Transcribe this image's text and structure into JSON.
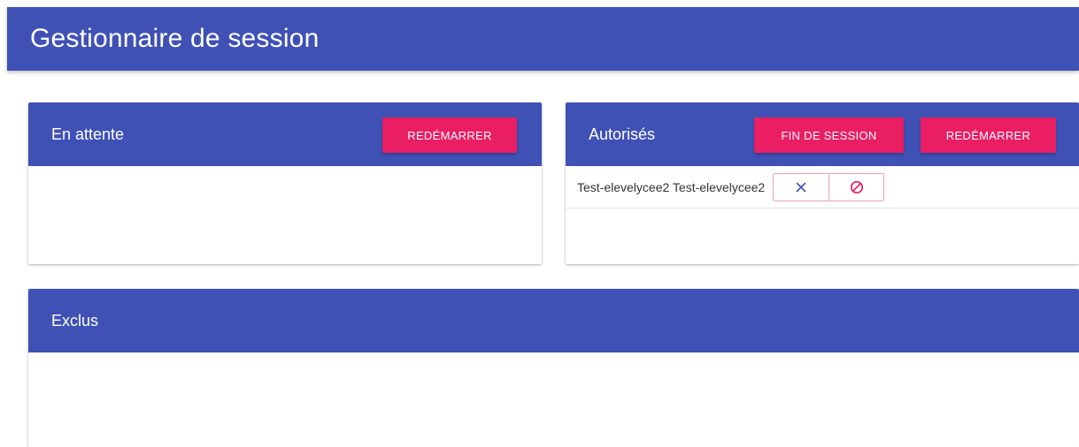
{
  "app": {
    "title": "Gestionnaire de session"
  },
  "waiting": {
    "title": "En attente",
    "restart_label": "REDÉMARRER"
  },
  "authorized": {
    "title": "Autorisés",
    "end_session_label": "FIN DE SESSION",
    "restart_label": "REDÉMARRER",
    "users": [
      {
        "name": "Test-elevelycee2 Test-elevelycee2",
        "remove_icon": "close-icon",
        "ban_icon": "block-icon"
      }
    ]
  },
  "excluded": {
    "title": "Exclus"
  },
  "colors": {
    "primary": "#3f51b5",
    "accent": "#e91e63"
  }
}
